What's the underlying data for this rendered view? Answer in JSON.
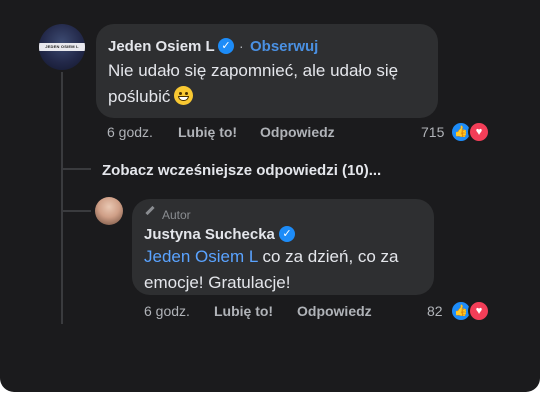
{
  "comment": {
    "author": "Jeden Osiem L",
    "follow": "Obserwuj",
    "separator": "·",
    "text_line1": "Nie udało się zapomnieć, ale udało się",
    "text_line2": "poślubić",
    "avatar_text": "JEDEN OSIEM L",
    "time": "6 godz.",
    "like": "Lubię to!",
    "reply": "Odpowiedz",
    "reactions": "715",
    "reaction_icons": [
      "like-icon",
      "love-icon"
    ]
  },
  "more_replies": "Zobacz wcześniejsze odpowiedzi (10)...",
  "reply": {
    "badge": "Autor",
    "author": "Justyna Suchecka",
    "mention": "Jeden Osiem L",
    "text_line1_rest": " co za dzień, co za",
    "text_line2": "emocje! Gratulacje!",
    "time": "6 godz.",
    "like": "Lubię to!",
    "reply": "Odpowiedz",
    "reactions": "82"
  },
  "colors": {
    "background": "#1b1b1d",
    "bubble": "#2e2f31",
    "accent": "#4a90e2",
    "like": "#1d8cf8",
    "love": "#f33e58"
  }
}
